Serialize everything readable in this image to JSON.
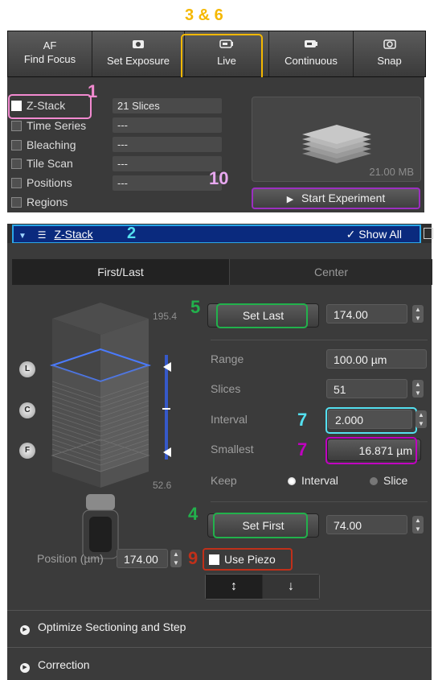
{
  "annotations": {
    "top": "3 & 6",
    "zstack_check": "1",
    "zstack_header": "2",
    "set_last": "5",
    "interval": "7",
    "smallest": "7",
    "set_first": "4",
    "piezo": "9",
    "start": "10"
  },
  "toolbar": {
    "af_top": "AF",
    "af_bottom": "Find Focus",
    "set_exposure": "Set Exposure",
    "live": "Live",
    "continuous": "Continuous",
    "snap": "Snap"
  },
  "dimensions": [
    {
      "label": "Z-Stack",
      "checked": true,
      "value": "21 Slices"
    },
    {
      "label": "Time Series",
      "checked": false,
      "value": "---"
    },
    {
      "label": "Bleaching",
      "checked": false,
      "value": "---"
    },
    {
      "label": "Tile Scan",
      "checked": false,
      "value": "---"
    },
    {
      "label": "Positions",
      "checked": false,
      "value": "---"
    },
    {
      "label": "Regions",
      "checked": false,
      "value": ""
    }
  ],
  "preview": {
    "size": "21.00 MB"
  },
  "start_experiment": "Start Experiment",
  "zstack": {
    "title": "Z-Stack",
    "show_all": "Show All",
    "tabs": [
      "First/Last",
      "Center"
    ],
    "scale_top": "195.4",
    "scale_bottom": "52.6",
    "set_last": "Set Last",
    "last_value": "174.00",
    "range_label": "Range",
    "range_value": "100.00 µm",
    "slices_label": "Slices",
    "slices_value": "51",
    "interval_label": "Interval",
    "interval_value": "2.000",
    "smallest_label": "Smallest",
    "smallest_value": "16.871 µm",
    "keep_label": "Keep",
    "keep_interval": "Interval",
    "keep_slice": "Slice",
    "set_first": "Set First",
    "first_value": "74.00",
    "position_label": "Position (µm)",
    "position_value": "174.00",
    "use_piezo": "Use Piezo",
    "side_buttons": [
      "L",
      "C",
      "F"
    ]
  },
  "sections": {
    "optimize": "Optimize Sectioning and Step",
    "correction": "Correction"
  },
  "colors": {
    "yellow": "#f5b800",
    "pink": "#f28ad0",
    "green": "#22b14c",
    "cyan": "#54e0f0",
    "magenta": "#c000c0",
    "red": "#c0301a",
    "purple": "#9b2fc0",
    "blue_header": "#0a2a7e"
  }
}
